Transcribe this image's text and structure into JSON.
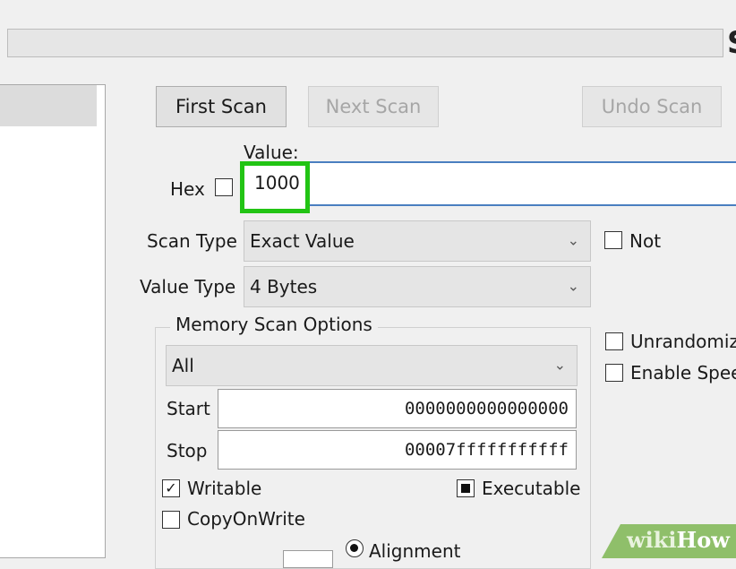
{
  "window": {
    "corner_glyph": "S"
  },
  "progress": {
    "fraction": 0.0
  },
  "buttons": {
    "first_scan": "First Scan",
    "next_scan": "Next Scan",
    "undo_scan": "Undo Scan"
  },
  "value": {
    "label": "Value:",
    "hex_label": "Hex",
    "hex_checked": false,
    "input_value": "1000",
    "highlight_color": "#22c414"
  },
  "scan_type": {
    "label": "Scan Type",
    "selected": "Exact Value",
    "not_label": "Not",
    "not_checked": false
  },
  "value_type": {
    "label": "Value Type",
    "selected": "4 Bytes"
  },
  "memory_scan_options": {
    "title": "Memory Scan Options",
    "region": "All",
    "start_label": "Start",
    "start_value": "0000000000000000",
    "stop_label": "Stop",
    "stop_value": "00007fffffffffff",
    "writable_label": "Writable",
    "writable_checked": true,
    "executable_label": "Executable",
    "executable_state": "indeterminate",
    "copyonwrite_label": "CopyOnWrite",
    "copyonwrite_checked": false,
    "alignment_label": "Alignment",
    "alignment_selected": true
  },
  "right_options": {
    "unrandomizer_label": "Unrandomiz",
    "enable_speedhack_label": "Enable Spee"
  },
  "watermark": {
    "wiki": "wiki",
    "how": "How",
    "band_color": "#8fbf6a"
  }
}
